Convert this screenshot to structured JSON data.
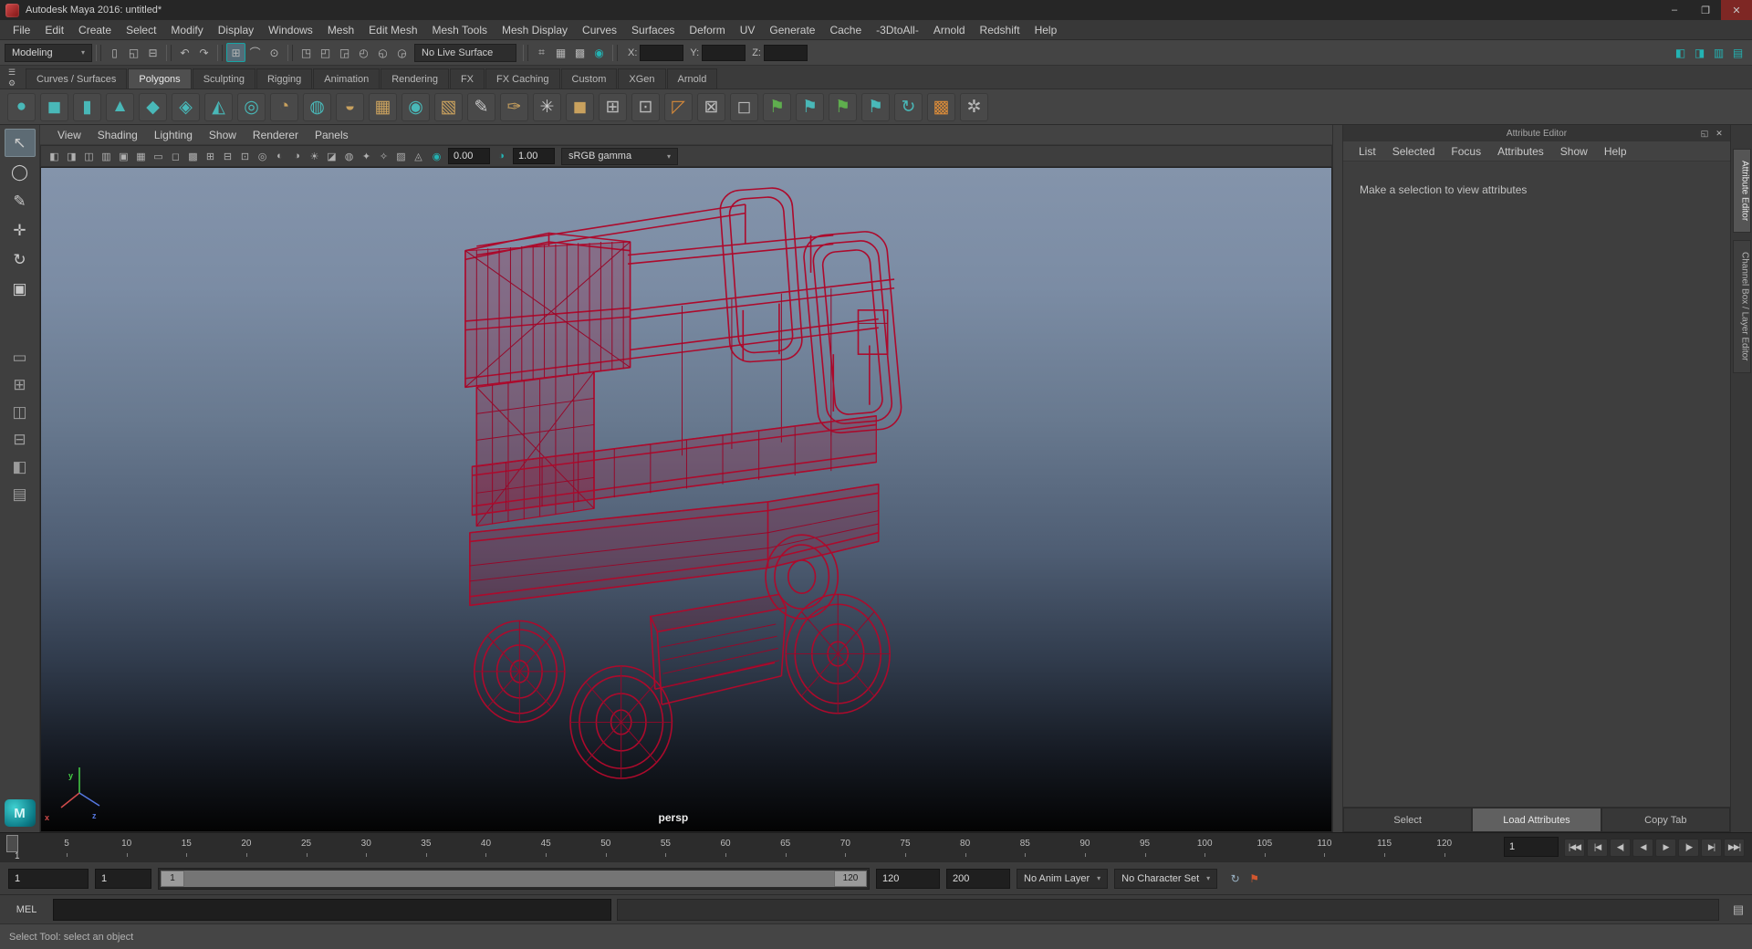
{
  "colors": {
    "wireframe_red": "#ad0a2c",
    "accent_teal": "#16a5a5",
    "viewport_top": "#8494ab",
    "selection_highlight": "#5d6b74"
  },
  "window": {
    "title": "Autodesk Maya 2016: untitled*",
    "controls": [
      {
        "name": "minimize-button",
        "glyph": "–"
      },
      {
        "name": "maximize-button",
        "glyph": "❐"
      },
      {
        "name": "close-button",
        "glyph": "✕"
      }
    ]
  },
  "menubar": {
    "items": [
      "File",
      "Edit",
      "Create",
      "Select",
      "Modify",
      "Display",
      "Windows",
      "Mesh",
      "Edit Mesh",
      "Mesh Tools",
      "Mesh Display",
      "Curves",
      "Surfaces",
      "Deform",
      "UV",
      "Generate",
      "Cache",
      "-3DtoAll-",
      "Arnold",
      "Redshift",
      "Help"
    ]
  },
  "statusline": {
    "menuset": "Modeling",
    "caret": "▾",
    "file_icons": [
      {
        "name": "new-scene-icon",
        "glyph": "▯"
      },
      {
        "name": "open-scene-icon",
        "glyph": "◱"
      },
      {
        "name": "save-scene-icon",
        "glyph": "⊟"
      }
    ],
    "undo_icons": [
      {
        "name": "undo-icon",
        "glyph": "↶"
      },
      {
        "name": "redo-icon",
        "glyph": "↷"
      }
    ],
    "snap_icons": [
      {
        "name": "snap-grid-icon",
        "glyph": "⊞",
        "active": true
      },
      {
        "name": "snap-curve-icon",
        "glyph": "⌒"
      },
      {
        "name": "snap-point-icon",
        "glyph": "⊙"
      }
    ],
    "mask_icons": [
      {
        "name": "select-hierarchy-icon",
        "glyph": "◳"
      },
      {
        "name": "select-object-icon",
        "glyph": "◰"
      },
      {
        "name": "select-component-icon",
        "glyph": "◲"
      },
      {
        "name": "highlight-icon",
        "glyph": "◴"
      },
      {
        "name": "rigging-mask-icon",
        "glyph": "◵"
      },
      {
        "name": "inputs-icon",
        "glyph": "◶"
      }
    ],
    "live_surface": "No Live Surface",
    "grid_icons": [
      {
        "name": "construction-history-icon",
        "glyph": "⌗"
      },
      {
        "name": "render-frame-icon",
        "glyph": "▦"
      },
      {
        "name": "ipr-frame-icon",
        "glyph": "▩"
      }
    ],
    "render_icon": {
      "name": "render-globe-icon",
      "glyph": "◉"
    },
    "coords": {
      "x": "X:",
      "y": "Y:",
      "z": "Z:"
    },
    "workspace_icons": [
      {
        "name": "toolbox-panel-icon",
        "glyph": "◧"
      },
      {
        "name": "attribute-panel-icon",
        "glyph": "◨"
      },
      {
        "name": "channel-panel-icon",
        "glyph": "▥"
      },
      {
        "name": "workspace-panel-icon",
        "glyph": "▤"
      }
    ]
  },
  "shelf": {
    "menu_icons": [
      {
        "name": "shelf-list-icon",
        "glyph": "☰"
      },
      {
        "name": "shelf-gear-icon",
        "glyph": "⚙"
      }
    ],
    "tabs": [
      {
        "label": "Curves / Surfaces"
      },
      {
        "label": "Polygons",
        "active": true
      },
      {
        "label": "Sculpting"
      },
      {
        "label": "Rigging"
      },
      {
        "label": "Animation"
      },
      {
        "label": "Rendering"
      },
      {
        "label": "FX"
      },
      {
        "label": "FX Caching"
      },
      {
        "label": "Custom"
      },
      {
        "label": "XGen"
      },
      {
        "label": "Arnold"
      }
    ],
    "icons": [
      {
        "name": "poly-sphere-icon",
        "glyph": "●",
        "color": "#49b8b8"
      },
      {
        "name": "poly-cube-icon",
        "glyph": "◼",
        "color": "#49b8b8"
      },
      {
        "name": "poly-cylinder-icon",
        "glyph": "▮",
        "color": "#49b8b8"
      },
      {
        "name": "poly-cone-icon",
        "glyph": "▲",
        "color": "#49b8b8"
      },
      {
        "name": "poly-torus-icon",
        "glyph": "◆",
        "color": "#49b8b8"
      },
      {
        "name": "poly-pyramid-icon",
        "glyph": "◈",
        "color": "#49b8b8"
      },
      {
        "name": "poly-prism-icon",
        "glyph": "◭",
        "color": "#49b8b8"
      },
      {
        "name": "poly-pipe-icon",
        "glyph": "◎",
        "color": "#49b8b8"
      },
      {
        "name": "poly-disc-icon",
        "glyph": "◔",
        "color": "#c9a15e"
      },
      {
        "name": "poly-plate-icon",
        "glyph": "◍",
        "color": "#49b8b8"
      },
      {
        "name": "poly-jar-icon",
        "glyph": "◒",
        "color": "#c9a15e"
      },
      {
        "name": "poly-plane-icon",
        "glyph": "▦",
        "color": "#c9a15e"
      },
      {
        "name": "sculpt-sphere-icon",
        "glyph": "◉",
        "color": "#49b8b8"
      },
      {
        "name": "uv-grid-icon",
        "glyph": "▧",
        "color": "#c9a15e"
      },
      {
        "name": "pencil-curve-icon",
        "glyph": "✎",
        "color": "#c9c9c9"
      },
      {
        "name": "quill-curve-icon",
        "glyph": "✑",
        "color": "#c9a15e"
      },
      {
        "name": "scatter-icon",
        "glyph": "✳",
        "color": "#c9c9c9"
      },
      {
        "name": "gold-cube-icon",
        "glyph": "◼",
        "color": "#c9a15e"
      },
      {
        "name": "add-divisions-icon",
        "glyph": "⊞",
        "color": "#b8b8b8"
      },
      {
        "name": "smooth-mesh-icon",
        "glyph": "⊡",
        "color": "#b8b8b8"
      },
      {
        "name": "extrude-icon",
        "glyph": "◸",
        "color": "#d98b3a"
      },
      {
        "name": "delete-edge-icon",
        "glyph": "⊠",
        "color": "#b8b8b8"
      },
      {
        "name": "multi-cut-icon",
        "glyph": "◻",
        "color": "#b8b8b8"
      },
      {
        "name": "quad-draw-icon",
        "glyph": "⚑",
        "color": "#5fae4e"
      },
      {
        "name": "target-weld-icon",
        "glyph": "⚑",
        "color": "#49b8b8"
      },
      {
        "name": "bridge-icon",
        "glyph": "⚑",
        "color": "#5fae4e"
      },
      {
        "name": "merge-icon",
        "glyph": "⚑",
        "color": "#49b8b8"
      },
      {
        "name": "curve-warp-icon",
        "glyph": "↻",
        "color": "#49b8b8"
      },
      {
        "name": "checker-map-icon",
        "glyph": "▩",
        "color": "#d98b3a"
      },
      {
        "name": "node-network-icon",
        "glyph": "✲",
        "color": "#b8b8b8"
      }
    ]
  },
  "toolbox": {
    "tools": [
      {
        "name": "select-tool",
        "glyph": "↖",
        "active": true
      },
      {
        "name": "lasso-select-tool",
        "glyph": "◯"
      },
      {
        "name": "paint-select-tool",
        "glyph": "✎"
      },
      {
        "name": "move-tool",
        "glyph": "✛"
      },
      {
        "name": "rotate-tool",
        "glyph": "↻"
      },
      {
        "name": "scale-tool",
        "glyph": "▣"
      }
    ],
    "layouts": [
      {
        "name": "layout-single-pane",
        "glyph": "▭"
      },
      {
        "name": "layout-four-pane",
        "glyph": "⊞"
      },
      {
        "name": "layout-two-side",
        "glyph": "◫"
      },
      {
        "name": "layout-two-stacked",
        "glyph": "⊟"
      },
      {
        "name": "layout-outliner-persp",
        "glyph": "◧"
      },
      {
        "name": "layout-hypershade-persp",
        "glyph": "▤"
      }
    ],
    "logo_letter": "M"
  },
  "panel_menu": {
    "items": [
      "View",
      "Shading",
      "Lighting",
      "Show",
      "Renderer",
      "Panels"
    ]
  },
  "viewport": {
    "toolbar_icons": [
      {
        "name": "select-camera-icon",
        "glyph": "◧"
      },
      {
        "name": "lock-camera-icon",
        "glyph": "◨"
      },
      {
        "name": "camera-attrs-icon",
        "glyph": "◫"
      },
      {
        "name": "bookmark-icon",
        "glyph": "▥"
      },
      {
        "name": "image-plane-icon",
        "glyph": "▣"
      },
      {
        "name": "view-grid-icon",
        "glyph": "▦"
      },
      {
        "name": "film-gate-icon",
        "glyph": "▭"
      },
      {
        "name": "resolution-gate-icon",
        "glyph": "◻"
      },
      {
        "name": "gate-mask-icon",
        "glyph": "▩"
      },
      {
        "name": "field-chart-icon",
        "glyph": "⊞"
      },
      {
        "name": "safe-action-icon",
        "glyph": "⊟"
      },
      {
        "name": "safe-title-icon",
        "glyph": "⊡"
      },
      {
        "name": "wireframe-mode-icon",
        "glyph": "◎"
      },
      {
        "name": "shaded-mode-icon",
        "glyph": "◐"
      },
      {
        "name": "textured-mode-icon",
        "glyph": "◑"
      },
      {
        "name": "lights-icon",
        "glyph": "☀"
      },
      {
        "name": "shadows-icon",
        "glyph": "◪"
      },
      {
        "name": "screen-ao-icon",
        "glyph": "◍"
      },
      {
        "name": "motion-blur-icon",
        "glyph": "✦"
      },
      {
        "name": "multisample-icon",
        "glyph": "✧"
      },
      {
        "name": "xray-icon",
        "glyph": "▨"
      },
      {
        "name": "isolate-select-icon",
        "glyph": "◬"
      }
    ],
    "exposure": {
      "icon": "◉",
      "value": "0.00"
    },
    "gamma": {
      "icon": "◑",
      "value": "1.00"
    },
    "color_mode": {
      "value": "sRGB gamma",
      "caret": "▾"
    },
    "camera_label": "persp",
    "axis": {
      "x": "x",
      "y": "y",
      "z": "z"
    }
  },
  "attribute_editor": {
    "panel_title": "Attribute Editor",
    "title_icons": [
      {
        "name": "ae-float-icon",
        "glyph": "◱"
      },
      {
        "name": "ae-close-icon",
        "glyph": "✕"
      }
    ],
    "menus": [
      "List",
      "Selected",
      "Focus",
      "Attributes",
      "Show",
      "Help"
    ],
    "message": "Make a selection to view attributes",
    "buttons": [
      {
        "name": "select-button",
        "label": "Select"
      },
      {
        "name": "load-attributes-button",
        "label": "Load Attributes",
        "active": true
      },
      {
        "name": "copy-tab-button",
        "label": "Copy Tab"
      }
    ]
  },
  "side_tabs": [
    {
      "name": "tab-attribute-editor",
      "label": "Attribute Editor",
      "active": true
    },
    {
      "name": "tab-channel-box",
      "label": "Channel Box / Layer Editor"
    }
  ],
  "timeline": {
    "ticks": [
      "5",
      "10",
      "15",
      "20",
      "25",
      "30",
      "35",
      "40",
      "45",
      "50",
      "55",
      "60",
      "65",
      "70",
      "75",
      "80",
      "85",
      "90",
      "95",
      "100",
      "105",
      "110",
      "115",
      "120"
    ],
    "marker_label": "1",
    "frame_field": "1",
    "playback": [
      {
        "name": "go-to-start-button",
        "glyph": "|◀◀"
      },
      {
        "name": "step-back-frame-button",
        "glyph": "|◀"
      },
      {
        "name": "step-back-key-button",
        "glyph": "◀|"
      },
      {
        "name": "play-backwards-button",
        "glyph": "◀"
      },
      {
        "name": "play-forwards-button",
        "glyph": "▶"
      },
      {
        "name": "step-forward-key-button",
        "glyph": "|▶"
      },
      {
        "name": "step-forward-frame-button",
        "glyph": "▶|"
      },
      {
        "name": "go-to-end-button",
        "glyph": "▶▶|"
      }
    ]
  },
  "range_slider": {
    "anim_start": "1",
    "play_start": "1",
    "handle_start": "1",
    "handle_end": "120",
    "play_end": "120",
    "anim_end": "200",
    "anim_layer": {
      "label": "No Anim Layer",
      "caret": "▾"
    },
    "character_set": {
      "label": "No Character Set",
      "caret": "▾"
    },
    "icons": [
      {
        "name": "anim-prefs-icon",
        "glyph": "↻",
        "color": "#9ab2c4"
      },
      {
        "name": "auto-key-icon",
        "glyph": "⚑",
        "color": "#d2572f"
      }
    ]
  },
  "command_line": {
    "label": "MEL",
    "icon": {
      "name": "script-editor-icon",
      "glyph": "▤"
    }
  },
  "help_line": {
    "text": "Select Tool: select an object"
  }
}
